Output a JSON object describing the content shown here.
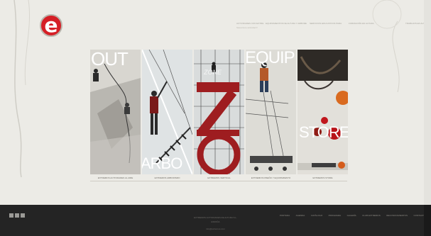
{
  "brand": {
    "logo_letter": "e"
  },
  "topnav": {
    "items": [
      {
        "label": "ACTIVIDADES CON EXTRE",
        "selected": "Seleccione actividad ▾"
      },
      {
        "label": "EQUIPAMIENTOS DE ALTURA Y ARBORE",
        "selected": ""
      },
      {
        "label": "SERVICIOS EDUCATIVOS PARA",
        "selected": ""
      },
      {
        "label": "FORMACIÓN EN ALTURA",
        "selected": ""
      },
      {
        "label": "TRABAJOS EN ALTURA",
        "selected": ""
      }
    ],
    "corner": "×"
  },
  "panels": [
    {
      "word": "OUT",
      "caption": "EXTREMOS ACTIVIDADES AL AIRE"
    },
    {
      "word": "ARBO",
      "caption": "EXTREMOS ARBORISMO"
    },
    {
      "word": "ZONE",
      "caption": "EXTREMOS VERTICAL"
    },
    {
      "word": "EQUIP",
      "caption": "EXTREMOS DISEÑO Y EQUIPAMIENTO"
    },
    {
      "word": "STORE",
      "caption": "EXTREMOS STORE"
    }
  ],
  "footer": {
    "nav": [
      "PORTADA",
      "AGENDA",
      "CATÁLOGO",
      "PROGRAMA",
      "GALERÍA",
      "CLUB EXTREMOS",
      "RECONOCIMIENTOS",
      "CONTACTO"
    ],
    "address_line1": "EXTREMOS ACTIVIDADES DE ALTURA S.L.",
    "address_line2": "ESPAÑA",
    "email": "info@extremos.com"
  },
  "colors": {
    "accent": "#d51f26",
    "zone_red": "#9e1d20",
    "footer_bg": "#242424",
    "page_bg": "#ecebe6"
  }
}
